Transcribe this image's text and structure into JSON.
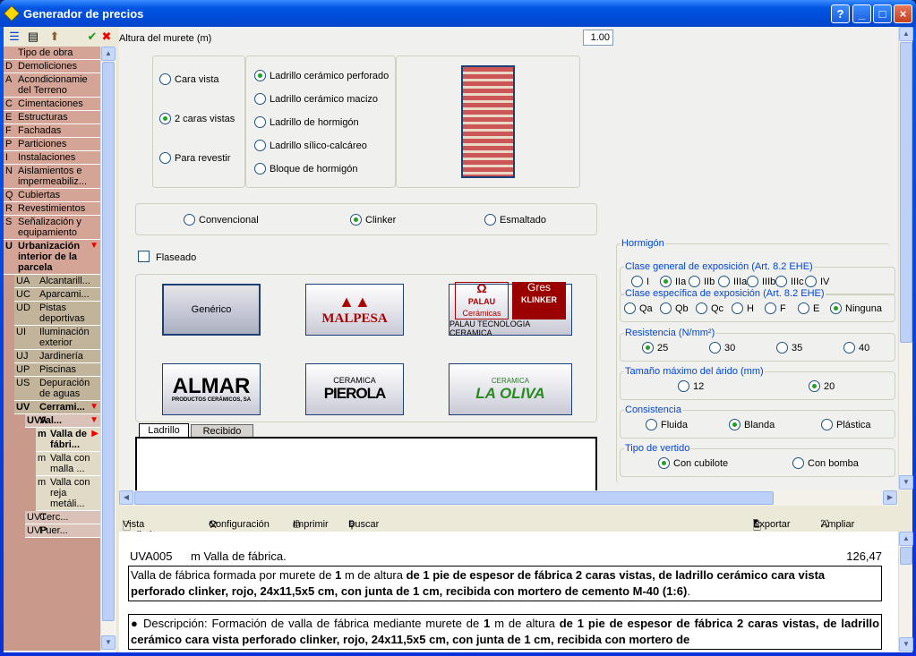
{
  "window": {
    "title": "Generador de precios",
    "buttons": [
      "?",
      "_",
      "□",
      "×"
    ]
  },
  "sidebar": {
    "items": [
      {
        "code": "",
        "label": "Tipo de obra",
        "level": 0
      },
      {
        "code": "D",
        "label": "Demoliciones",
        "level": 0
      },
      {
        "code": "A",
        "label": "Acondicionamie del Terreno",
        "level": 0
      },
      {
        "code": "C",
        "label": "Cimentaciones",
        "level": 0
      },
      {
        "code": "E",
        "label": "Estructuras",
        "level": 0
      },
      {
        "code": "F",
        "label": "Fachadas",
        "level": 0
      },
      {
        "code": "P",
        "label": "Particiones",
        "level": 0
      },
      {
        "code": "I",
        "label": "Instalaciones",
        "level": 0
      },
      {
        "code": "N",
        "label": "Aislamientos e impermeabiliz...",
        "level": 0
      },
      {
        "code": "Q",
        "label": "Cubiertas",
        "level": 0
      },
      {
        "code": "R",
        "label": "Revestimientos",
        "level": 0
      },
      {
        "code": "S",
        "label": "Señalización y equipamiento",
        "level": 0
      },
      {
        "code": "U",
        "label": "Urbanización interior de la parcela",
        "level": 0,
        "bold": true,
        "expanded": true
      },
      {
        "code": "UA",
        "label": "Alcantarill...",
        "level": 1
      },
      {
        "code": "UC",
        "label": "Aparcami...",
        "level": 1
      },
      {
        "code": "UD",
        "label": "Pistas deportivas",
        "level": 1
      },
      {
        "code": "UI",
        "label": "Iluminación exterior",
        "level": 1
      },
      {
        "code": "UJ",
        "label": "Jardinería",
        "level": 1
      },
      {
        "code": "UP",
        "label": "Piscinas",
        "level": 1
      },
      {
        "code": "US",
        "label": "Depuración de aguas",
        "level": 1
      },
      {
        "code": "UV",
        "label": "Cerrami...",
        "level": 1,
        "bold": true,
        "expanded": true
      },
      {
        "code": "UVA",
        "label": "Val...",
        "level": 2,
        "bold": true,
        "expanded": true
      },
      {
        "code": "m",
        "label": "Valla de fábri...",
        "level": 3,
        "bold": true,
        "selected": true
      },
      {
        "code": "m",
        "label": "Valla con malla ...",
        "level": 3
      },
      {
        "code": "m",
        "label": "Valla con reja metáli...",
        "level": 3
      },
      {
        "code": "UVT",
        "label": "Cerc...",
        "level": 2
      },
      {
        "code": "UVP",
        "label": "Puer...",
        "level": 2
      }
    ]
  },
  "main": {
    "altura_label": "Altura del murete (m)",
    "altura_value": "1.00",
    "caras": [
      {
        "label": "Cara vista",
        "on": false
      },
      {
        "label": "2 caras vistas",
        "on": true
      },
      {
        "label": "Para revestir",
        "on": false
      }
    ],
    "material": [
      {
        "label": "Ladrillo cerámico perforado",
        "on": true
      },
      {
        "label": "Ladrillo cerámico macizo",
        "on": false
      },
      {
        "label": "Ladrillo de hormigón",
        "on": false
      },
      {
        "label": "Ladrillo sílico-calcáreo",
        "on": false
      },
      {
        "label": "Bloque de hormigón",
        "on": false
      }
    ],
    "acabado": [
      {
        "label": "Convencional",
        "on": false
      },
      {
        "label": "Clinker",
        "on": true
      },
      {
        "label": "Esmaltado",
        "on": false
      }
    ],
    "flaseado": "Flaseado",
    "brands": {
      "generico": "Genérico",
      "malpesa": "MALPESA",
      "palau": "PALAU TECNOLOGIA CERAMICA",
      "palau1": "PALAU",
      "palau2": "Cerámicas",
      "palau3": "Gres",
      "palau4": "KLINKER",
      "almar": "ALMAR",
      "almar_sub": "PRODUCTOS CERÁMICOS, SA",
      "pierola1": "CERAMICA",
      "pierola2": "PIEROLA",
      "oliva1": "CERAMICA",
      "oliva2": "LA OLIVA"
    },
    "tabs": [
      "Ladrillo",
      "Recibido"
    ]
  },
  "hormigon": {
    "title": "Hormigón",
    "groups": [
      {
        "label": "Clase general de exposición (Art. 8.2 EHE)",
        "options": [
          "I",
          "IIa",
          "IIb",
          "IIIa",
          "IIIb",
          "IIIc",
          "IV"
        ],
        "selected": 1
      },
      {
        "label": "Clase específica de exposición (Art. 8.2 EHE)",
        "options": [
          "Qa",
          "Qb",
          "Qc",
          "H",
          "F",
          "E",
          "Ninguna"
        ],
        "selected": 6
      },
      {
        "label": "Resistencia (N/mm²)",
        "options": [
          "25",
          "30",
          "35",
          "40"
        ],
        "selected": 0
      },
      {
        "label": "Tamaño máximo del árido (mm)",
        "options": [
          "12",
          "20"
        ],
        "selected": 1
      },
      {
        "label": "Consistencia",
        "options": [
          "Fluida",
          "Blanda",
          "Plástica"
        ],
        "selected": 1
      },
      {
        "label": "Tipo de vertido",
        "options": [
          "Con cubilote",
          "Con bomba"
        ],
        "selected": 0
      }
    ]
  },
  "toolbar": {
    "preview": "Vista preliminar",
    "config": "Configuración",
    "print": "Imprimir",
    "search": "Buscar",
    "export": "Exportar",
    "expand": "Ampliar ventana"
  },
  "doc": {
    "code": "UVA005",
    "title": "m Valla de fábrica.",
    "price": "126,47",
    "p1a": "Valla de fábrica formada por murete de ",
    "p1b": "1",
    "p1c": " m de altura ",
    "p1d": "de 1 pie de espesor de fábrica 2 caras vistas, de ladrillo cerámico cara vista perforado clinker, rojo, 24x11,5x5 cm, con junta de 1 cm, recibida con mortero de cemento M-40 (1:6)",
    "p1e": ".",
    "p2a": "● Descripción: Formación de valla de fábrica mediante murete de ",
    "p2b": "1",
    "p2c": " m de altura ",
    "p2d": "de 1 pie de espesor de fábrica 2 caras vistas, de ladrillo cerámico cara vista perforado clinker, rojo, 24x11,5x5 cm, con junta de 1 cm, recibida con mortero de"
  }
}
